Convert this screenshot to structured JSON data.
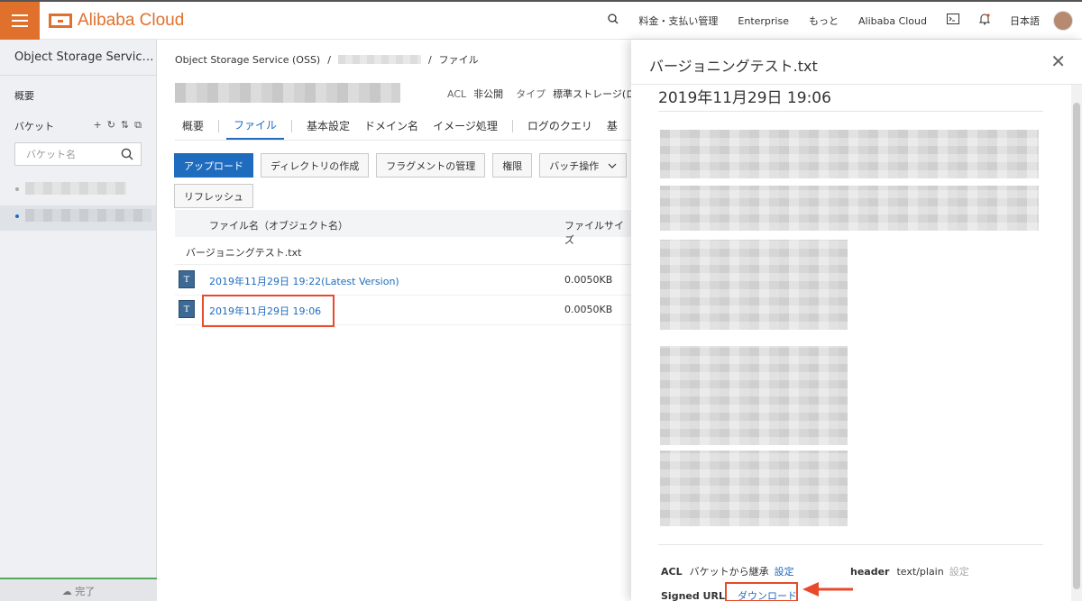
{
  "topbar": {
    "brand": "Alibaba Cloud",
    "nav": [
      "料金・支払い管理",
      "Enterprise",
      "もっと",
      "Alibaba Cloud",
      "日本語"
    ],
    "accent": "#e0712c"
  },
  "sidebar": {
    "title": "Object Storage Servic…",
    "overview": "概要",
    "bucket_heading": "バケット",
    "search_placeholder": "バケット名",
    "footer": "完了"
  },
  "main": {
    "breadcrumb": [
      "Object Storage Service (OSS)",
      "/",
      "/",
      "ファイル"
    ],
    "meta": {
      "acl_label": "ACL",
      "acl_value": "非公開",
      "type_label": "タイプ",
      "type_value": "標準ストレージ(ロ"
    },
    "tabs": [
      "概要",
      "ファイル",
      "基本設定",
      "ドメイン名",
      "イメージ処理",
      "ログのクエリ",
      "基"
    ],
    "buttons": [
      "アップロード",
      "ディレクトリの作成",
      "フラグメントの管理",
      "権限",
      "バッチ操作",
      "リフレッシュ"
    ],
    "table": {
      "col_name": "ファイル名（オブジェクト名）",
      "col_size": "ファイルサイズ",
      "folder": "バージョニングテスト.txt",
      "rows": [
        {
          "name": "2019年11月29日 19:22(Latest Version)",
          "size": "0.0050KB",
          "icon": "T"
        },
        {
          "name": "2019年11月29日 19:06",
          "size": "0.0050KB",
          "icon": "T"
        }
      ]
    }
  },
  "drawer": {
    "title": "バージョニングテスト.txt",
    "preview_title": "2019年11月29日 19:06",
    "acl_label": "ACL",
    "acl_value": "バケットから継承",
    "acl_link": "設定",
    "header_label": "header",
    "header_value": "text/plain",
    "header_link": "設定",
    "signed_url_label": "Signed URL",
    "download_link": "ダウンロード"
  },
  "colors": {
    "link": "#1f6cbf",
    "annotation": "#e84a2b"
  }
}
